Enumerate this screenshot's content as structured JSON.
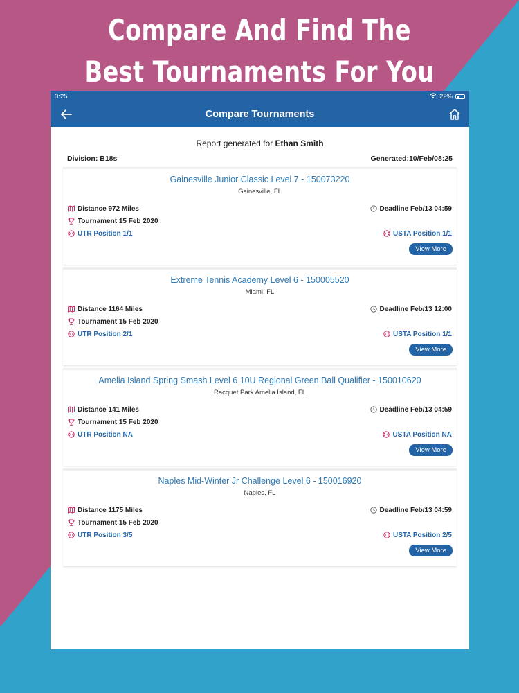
{
  "headline": [
    "Compare And Find The",
    "Best Tournaments For You"
  ],
  "status": {
    "time": "3:25",
    "battery": "22%"
  },
  "nav": {
    "title": "Compare Tournaments"
  },
  "report": {
    "prefix": "Report generated for ",
    "name": "Ethan Smith"
  },
  "division": "Division: B18s",
  "generated": "Generated:10/Feb/08:25",
  "view_more_label": "View More",
  "tournaments": [
    {
      "title": "Gainesville Junior Classic Level 7 - 150073220",
      "location": "Gainesville, FL",
      "distance": "Distance 972 Miles",
      "deadline": "Deadline Feb/13 04:59",
      "tournament": "Tournament 15 Feb 2020",
      "utr": "UTR Position 1/1",
      "usta": "USTA Position 1/1"
    },
    {
      "title": "Extreme Tennis Academy Level 6 - 150005520",
      "location": "Miami, FL",
      "distance": "Distance 1164 Miles",
      "deadline": "Deadline Feb/13 12:00",
      "tournament": "Tournament 15 Feb 2020",
      "utr": "UTR Position 2/1",
      "usta": "USTA Position 1/1"
    },
    {
      "title": "Amelia Island Spring Smash Level 6 10U Regional Green Ball Qualifier - 150010620",
      "location": "Racquet Park Amelia Island, FL",
      "distance": "Distance 141 Miles",
      "deadline": "Deadline Feb/13 04:59",
      "tournament": "Tournament 15 Feb 2020",
      "utr": "UTR Position NA",
      "usta": "USTA Position NA"
    },
    {
      "title": "Naples Mid-Winter Jr Challenge Level 6 - 150016920",
      "location": "Naples, FL",
      "distance": "Distance 1175 Miles",
      "deadline": "Deadline Feb/13 04:59",
      "tournament": "Tournament 15 Feb 2020",
      "utr": "UTR Position 3/5",
      "usta": "USTA Position 2/5"
    }
  ],
  "colors": {
    "header": "#2364a6",
    "link": "#2d7ab6",
    "bg_pink": "#b65786",
    "bg_blue": "#31a2c9",
    "icon_pink": "#c2185b"
  }
}
